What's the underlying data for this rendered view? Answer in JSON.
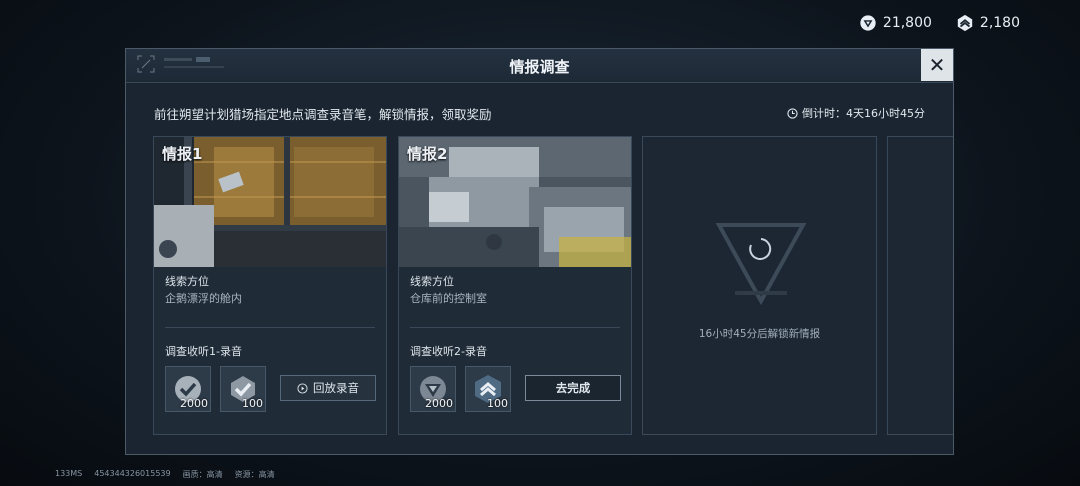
{
  "currency": [
    {
      "icon": "gem-badge-icon",
      "amount": "21,800"
    },
    {
      "icon": "chevron-rank-icon",
      "amount": "2,180"
    }
  ],
  "panel": {
    "title": "情报调查",
    "description": "前往朔望计划猎场指定地点调查录音笔，解锁情报，领取奖励",
    "timer_label": "倒计时：4天16小时45分"
  },
  "cards": [
    {
      "tag": "情报1",
      "clue_label": "线索方位",
      "clue_value": "企鹅漂浮的舱内",
      "task": "调查收听1-录音",
      "rewards": [
        {
          "icon": "checkmark-badge-icon",
          "amount": "2000"
        },
        {
          "icon": "checkmark-badge-icon",
          "amount": "100"
        }
      ],
      "button": "回放录音"
    },
    {
      "tag": "情报2",
      "clue_label": "线索方位",
      "clue_value": "仓库前的控制室",
      "task": "调查收听2-录音",
      "rewards": [
        {
          "icon": "gem-badge-icon",
          "amount": "2000"
        },
        {
          "icon": "chevron-rank-icon",
          "amount": "100"
        }
      ],
      "button": "去完成"
    }
  ],
  "locked": {
    "message": "16小时45分后解锁新情报"
  },
  "footer": {
    "ping": "133MS",
    "uid": "454344326015539",
    "quality": "画质：高清",
    "resource": "资源：高清"
  },
  "colors": {
    "panel_bg": "#1a2531",
    "accent": "#dfe4e8"
  }
}
